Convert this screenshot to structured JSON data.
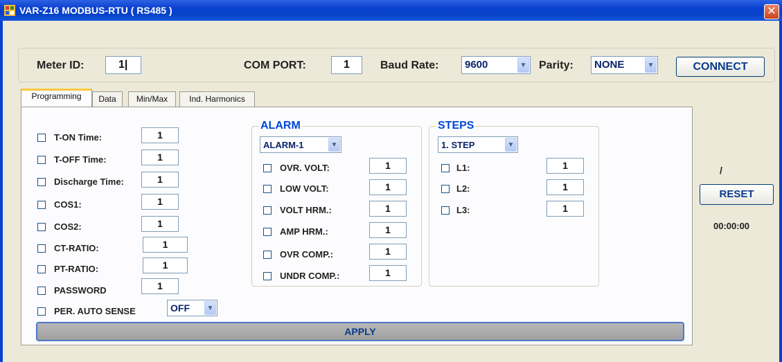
{
  "window": {
    "title": "VAR-Z16 MODBUS-RTU ( RS485 )",
    "close_label": "✕"
  },
  "connection": {
    "meter_id_label": "Meter ID:",
    "meter_id_value": "1|",
    "com_port_label": "COM PORT:",
    "com_port_value": "1",
    "baud_rate_label": "Baud Rate:",
    "baud_rate_value": "9600",
    "parity_label": "Parity:",
    "parity_value": "NONE",
    "connect_label": "CONNECT"
  },
  "tabs": [
    "Programming",
    "Data",
    "Min/Max",
    "Ind. Harmonics"
  ],
  "programming": {
    "items": [
      {
        "label": "T-ON Time:",
        "value": "1"
      },
      {
        "label": "T-OFF Time:",
        "value": "1"
      },
      {
        "label": "Discharge Time:",
        "value": "1"
      },
      {
        "label": "COS1:",
        "value": "1"
      },
      {
        "label": "COS2:",
        "value": "1"
      },
      {
        "label": "CT-RATIO:",
        "value": "1"
      },
      {
        "label": "PT-RATIO:",
        "value": "1"
      },
      {
        "label": "PASSWORD",
        "value": "1"
      }
    ],
    "auto_sense_label": "PER. AUTO SENSE",
    "auto_sense_value": "OFF"
  },
  "alarm": {
    "title": "ALARM",
    "selected": "ALARM-1",
    "items": [
      {
        "label": "OVR. VOLT:",
        "value": "1"
      },
      {
        "label": "LOW VOLT:",
        "value": "1"
      },
      {
        "label": "VOLT HRM.:",
        "value": "1"
      },
      {
        "label": "AMP HRM.:",
        "value": "1"
      },
      {
        "label": "OVR COMP.:",
        "value": "1"
      },
      {
        "label": "UNDR COMP.:",
        "value": "1"
      }
    ]
  },
  "steps": {
    "title": "STEPS",
    "selected": "1. STEP",
    "items": [
      {
        "label": "L1:",
        "value": "1"
      },
      {
        "label": "L2:",
        "value": "1"
      },
      {
        "label": "L3:",
        "value": "1"
      }
    ]
  },
  "side": {
    "slash_text": "/",
    "reset_label": "RESET",
    "timer": "00:00:00"
  },
  "apply_label": "APPLY",
  "icons": {
    "app": "app-window-icon",
    "dropdown": "chevron-down-icon"
  },
  "colors": {
    "titlebar": "#0a3fd0",
    "accent_text": "#0a3a8c",
    "group_title": "#0046d5"
  }
}
